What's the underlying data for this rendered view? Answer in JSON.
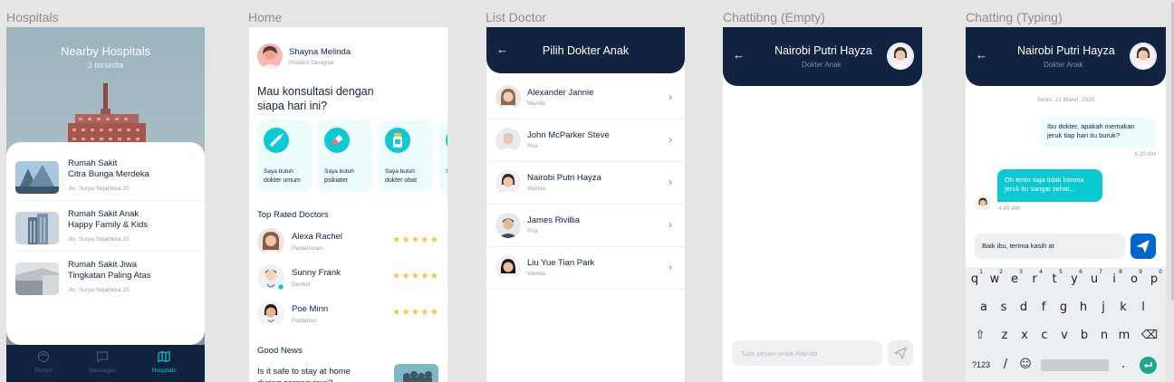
{
  "frames": {
    "hospitals": "Hospitals",
    "home": "Home",
    "list_doctor": "List Doctor",
    "chat_empty": "Chattibng (Empty)",
    "chat_typing": "Chatting (Typing)"
  },
  "hospitals": {
    "title": "Nearby Hospitals",
    "subtitle": "3 tersedia",
    "items": [
      {
        "name_line1": "Rumah Sakit",
        "name_line2": "Citra Bunga Merdeka",
        "address": "Jln. Surya Sejahtera 20"
      },
      {
        "name_line1": "Rumah Sakit Anak",
        "name_line2": "Happy Family & Kids",
        "address": "Jln. Surya Sejahtera 20"
      },
      {
        "name_line1": "Rumah Sakit Jiwa",
        "name_line2": "Tingkatan Paling Atas",
        "address": "Jln. Surya Sejahtera 20"
      }
    ],
    "tabs": [
      {
        "label": "Doctor",
        "icon": "doctor-icon",
        "active": false
      },
      {
        "label": "Messages",
        "icon": "messages-icon",
        "active": false
      },
      {
        "label": "Hospitals",
        "icon": "map-icon",
        "active": true
      }
    ]
  },
  "home": {
    "user_name": "Shayna Melinda",
    "user_role": "Product Designer",
    "greeting": "Mau konsultasi dengan siapa hari ini?",
    "categories": [
      {
        "line1": "Saya butuh",
        "line2": "dokter umum",
        "icon": "injection-icon"
      },
      {
        "line1": "Saya butuh",
        "line2": "psikiater",
        "icon": "pill-icon"
      },
      {
        "line1": "Saya butuh",
        "line2": "dokter obat",
        "icon": "medicine-bottle-icon"
      },
      {
        "line1": "S",
        "line2": "",
        "icon": "category-icon"
      }
    ],
    "top_rated_title": "Top Rated Doctors",
    "doctors": [
      {
        "name": "Alexa Rachel",
        "specialty": "Pediatrician",
        "stars": "★★★★★"
      },
      {
        "name": "Sunny Frank",
        "specialty": "Dentist",
        "stars": "★★★★★"
      },
      {
        "name": "Poe Minn",
        "specialty": "Podiatrist",
        "stars": "★★★★★"
      }
    ],
    "news_title": "Good News",
    "news_item": "Is it safe to stay at home during coronavirus?"
  },
  "list_doctor": {
    "title": "Pilih Dokter Anak",
    "doctors": [
      {
        "name": "Alexander Jannie",
        "gender": "Wanita"
      },
      {
        "name": "John McParker Steve",
        "gender": "Pria"
      },
      {
        "name": "Nairobi Putri Hayza",
        "gender": "Wanita"
      },
      {
        "name": "James Rivillia",
        "gender": "Pria"
      },
      {
        "name": "Liu Yue Tian Park",
        "gender": "Wanita"
      }
    ]
  },
  "chat_empty": {
    "doctor_name": "Nairobi Putri Hayza",
    "doctor_role": "Dokter Anak",
    "input_placeholder": "Tulis pesan untuk Nairobi"
  },
  "chat_typing": {
    "doctor_name": "Nairobi Putri Hayza",
    "doctor_role": "Dokter Anak",
    "date": "Senin, 21 Maret, 2020",
    "my_message": "Ibu dokter, apakah memakan jeruk tiap hari itu buruk?",
    "my_time": "4.20 AM",
    "their_message": "Oh tentu saja tidak karena jeruk itu sangat sehat...",
    "their_time": "4.45 AM",
    "input_value": "Baik ibu, terima kasih at",
    "keyboard": {
      "row1": [
        "q",
        "w",
        "e",
        "r",
        "t",
        "y",
        "u",
        "i",
        "o",
        "p"
      ],
      "row1_nums": [
        "1",
        "2",
        "3",
        "4",
        "5",
        "6",
        "7",
        "8",
        "9",
        "0"
      ],
      "row2": [
        "a",
        "s",
        "d",
        "f",
        "g",
        "h",
        "j",
        "k",
        "l"
      ],
      "row3": [
        "z",
        "x",
        "c",
        "v",
        "b",
        "n",
        "m"
      ],
      "sym_label": "?123",
      "slash": "/",
      "period": "."
    }
  },
  "colors": {
    "navy": "#112340",
    "cyan": "#0bcad4",
    "send_blue": "#0066cb",
    "star": "#f5c24d"
  }
}
